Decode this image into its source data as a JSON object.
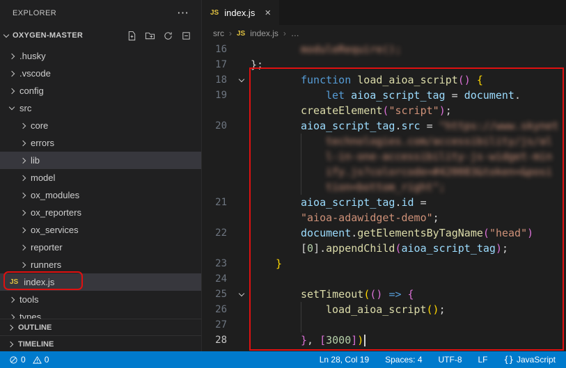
{
  "colors": {
    "status_accent": "#007acc",
    "annotation_red": "#e01010",
    "js_icon_yellow": "#e2c341",
    "selection_bg": "#37373d"
  },
  "explorer": {
    "title": "EXPLORER",
    "more_label": "⋯",
    "section": {
      "name": "OXYGEN-MASTER"
    },
    "tree": [
      {
        "label": ".husky",
        "kind": "folder",
        "depth": 0
      },
      {
        "label": ".vscode",
        "kind": "folder",
        "depth": 0
      },
      {
        "label": "config",
        "kind": "folder",
        "depth": 0
      },
      {
        "label": "src",
        "kind": "folder",
        "depth": 0,
        "expanded": true
      },
      {
        "label": "core",
        "kind": "folder",
        "depth": 1
      },
      {
        "label": "errors",
        "kind": "folder",
        "depth": 1
      },
      {
        "label": "lib",
        "kind": "folder",
        "depth": 1,
        "highlighted": true
      },
      {
        "label": "model",
        "kind": "folder",
        "depth": 1
      },
      {
        "label": "ox_modules",
        "kind": "folder",
        "depth": 1
      },
      {
        "label": "ox_reporters",
        "kind": "folder",
        "depth": 1
      },
      {
        "label": "ox_services",
        "kind": "folder",
        "depth": 1
      },
      {
        "label": "reporter",
        "kind": "folder",
        "depth": 1
      },
      {
        "label": "runners",
        "kind": "folder",
        "depth": 1
      },
      {
        "label": "index.js",
        "kind": "js-file",
        "depth": 0,
        "selected": true,
        "annotated": true
      },
      {
        "label": "tools",
        "kind": "folder",
        "depth": 0
      },
      {
        "label": "types",
        "kind": "folder",
        "depth": 0
      }
    ],
    "panels": {
      "outline": "OUTLINE",
      "timeline": "TIMELINE"
    }
  },
  "tab": {
    "icon": "JS",
    "label": "index.js",
    "close": "×"
  },
  "breadcrumb": {
    "items": {
      "0": "src",
      "1": "index.js",
      "2": "…"
    },
    "separator": "›"
  },
  "editor": {
    "rows": [
      {
        "n": "16",
        "ind": 72,
        "tokens": [
          [
            "moduleRequire();",
            "str",
            1
          ]
        ]
      },
      {
        "n": "17",
        "ind": 0,
        "tokens": [
          [
            "};",
            "pun"
          ]
        ]
      },
      {
        "n": "18",
        "fold": 1,
        "ind": 72,
        "tokens": [
          [
            "function",
            "kw"
          ],
          [
            " ",
            "pun"
          ],
          [
            "load_aioa_script",
            "fn"
          ],
          [
            "()",
            "b2"
          ],
          [
            " ",
            "pun"
          ],
          [
            "{",
            "b1"
          ]
        ]
      },
      {
        "n": "19",
        "ind": 108,
        "tokens": [
          [
            "let",
            "kw"
          ],
          [
            " ",
            "pun"
          ],
          [
            "aioa_script_tag",
            "var"
          ],
          [
            " = ",
            "pun"
          ],
          [
            "document",
            "var"
          ],
          [
            ".",
            "pun"
          ]
        ]
      },
      {
        "n": "",
        "ind": 72,
        "tokens": [
          [
            "createElement",
            "fn"
          ],
          [
            "(",
            "b2"
          ],
          [
            "\"script\"",
            "str"
          ],
          [
            ")",
            "b2"
          ],
          [
            ";",
            "pun"
          ]
        ]
      },
      {
        "n": "20",
        "ind": 72,
        "tokens": [
          [
            "aioa_script_tag",
            "var"
          ],
          [
            ".",
            "pun"
          ],
          [
            "src",
            "var"
          ],
          [
            " = ",
            "pun"
          ],
          [
            "\"https://www.skynet",
            "str",
            1
          ]
        ]
      },
      {
        "n": "",
        "ind": 108,
        "guide": 72,
        "tokens": [
          [
            "technologies.com/accessibility/js/al",
            "str",
            1
          ]
        ]
      },
      {
        "n": "",
        "ind": 108,
        "guide": 72,
        "tokens": [
          [
            "l-in-one-accessibility-js-widget-min",
            "str",
            1
          ]
        ]
      },
      {
        "n": "",
        "ind": 108,
        "guide": 72,
        "tokens": [
          [
            "ify.js?colorcode=#420083&token=&posi",
            "str",
            1
          ]
        ]
      },
      {
        "n": "",
        "ind": 108,
        "guide": 72,
        "tokens": [
          [
            "tion=bottom_right\";",
            "str",
            1
          ]
        ]
      },
      {
        "n": "21",
        "ind": 72,
        "tokens": [
          [
            "aioa_script_tag",
            "var"
          ],
          [
            ".",
            "pun"
          ],
          [
            "id",
            "var"
          ],
          [
            " =",
            "pun"
          ]
        ]
      },
      {
        "n": "",
        "ind": 72,
        "tokens": [
          [
            "\"aioa-adawidget-demo\"",
            "str"
          ],
          [
            ";",
            "pun"
          ]
        ]
      },
      {
        "n": "22",
        "ind": 72,
        "tokens": [
          [
            "document",
            "var"
          ],
          [
            ".",
            "pun"
          ],
          [
            "getElementsByTagName",
            "fn"
          ],
          [
            "(",
            "b2"
          ],
          [
            "\"head\"",
            "str"
          ],
          [
            ")",
            "b2"
          ]
        ]
      },
      {
        "n": "",
        "ind": 72,
        "tokens": [
          [
            "[",
            "pun"
          ],
          [
            "0",
            "num"
          ],
          [
            "]",
            "pun"
          ],
          [
            ".",
            "pun"
          ],
          [
            "appendChild",
            "fn"
          ],
          [
            "(",
            "b2"
          ],
          [
            "aioa_script_tag",
            "var"
          ],
          [
            ")",
            "b2"
          ],
          [
            ";",
            "pun"
          ]
        ]
      },
      {
        "n": "23",
        "ind": 36,
        "tokens": [
          [
            "}",
            "b1"
          ]
        ]
      },
      {
        "n": "24",
        "ind": 0,
        "tokens": []
      },
      {
        "n": "25",
        "fold": 1,
        "ind": 72,
        "tokens": [
          [
            "setTimeout",
            "fn"
          ],
          [
            "(",
            "b1"
          ],
          [
            "()",
            "b2"
          ],
          [
            " ",
            "pun"
          ],
          [
            "=>",
            "kw"
          ],
          [
            " ",
            "pun"
          ],
          [
            "{",
            "b2"
          ]
        ]
      },
      {
        "n": "26",
        "ind": 108,
        "guide": 72,
        "tokens": [
          [
            "load_aioa_script",
            "fn"
          ],
          [
            "()",
            "b1"
          ],
          [
            ";",
            "pun"
          ]
        ]
      },
      {
        "n": "27",
        "ind": 0,
        "guide": 72,
        "tokens": []
      },
      {
        "n": "28",
        "ind": 72,
        "active": 1,
        "cursor": 1,
        "tokens": [
          [
            "}",
            "b2"
          ],
          [
            ", ",
            "pun"
          ],
          [
            "[",
            "b2"
          ],
          [
            "3000",
            "num"
          ],
          [
            "]",
            "b2"
          ],
          [
            ")",
            "b1"
          ]
        ]
      }
    ]
  },
  "status_bar": {
    "left": {
      "errors": "0",
      "warnings": "0"
    },
    "right": {
      "cursor": "Ln 28, Col 19",
      "indent": "Spaces: 4",
      "encoding": "UTF-8",
      "eol": "LF",
      "language_icon": "{}",
      "language": "JavaScript"
    }
  }
}
